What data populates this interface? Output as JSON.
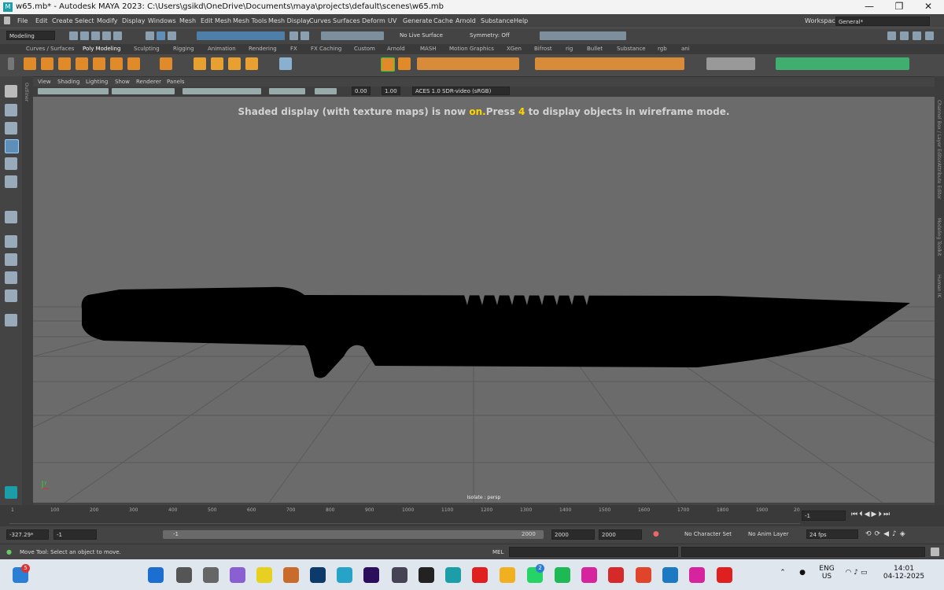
{
  "window": {
    "title": "w65.mb* - Autodesk MAYA 2023: C:\\Users\\gsikd\\OneDrive\\Documents\\maya\\projects\\default\\scenes\\w65.mb",
    "minimize": "—",
    "maximize": "❐",
    "close": "✕"
  },
  "menus": [
    "File",
    "Edit",
    "Create",
    "Select",
    "Modify",
    "Display",
    "Windows",
    "Mesh",
    "Edit Mesh",
    "Mesh Tools",
    "Mesh Display",
    "Curves",
    "Surfaces",
    "Deform",
    "UV",
    "Generate",
    "Cache",
    "Arnold",
    "Substance",
    "Help"
  ],
  "workspace": {
    "label": "Workspace:",
    "value": "General*"
  },
  "status": {
    "mode": "Modeling",
    "live_surface": "No Live Surface",
    "symmetry": "Symmetry: Off"
  },
  "shelf_tabs": [
    "Curves / Surfaces",
    "Poly Modeling",
    "Sculpting",
    "Rigging",
    "Animation",
    "Rendering",
    "FX",
    "FX Caching",
    "Custom",
    "Arnold",
    "MASH",
    "Motion Graphics",
    "XGen",
    "Bifrost",
    "rig",
    "Bullet",
    "Substance",
    "rgb",
    "ani"
  ],
  "shelf_active": "Poly Modeling",
  "panel_menu": [
    "View",
    "Shading",
    "Lighting",
    "Show",
    "Renderer",
    "Panels"
  ],
  "panel_toolbar": {
    "exposure": "0.00",
    "gamma": "1.00",
    "colorspace": "ACES 1.0 SDR-video (sRGB)"
  },
  "viewport": {
    "hud_pre": "Shaded display (with texture maps) is now ",
    "hud_on": "on.",
    "hud_mid": "Press ",
    "hud_key": "4",
    "hud_post": " to display objects in wireframe mode.",
    "isolate": "Isolate : persp",
    "axis_y": "y"
  },
  "side_labels": {
    "outliner": "Outliner",
    "channel_box": "Channel Box / Layer Editor",
    "attribute_editor": "Attribute Editor",
    "modeling_toolkit": "Modeling Toolkit",
    "human_ik": "Human IK"
  },
  "timeline": {
    "ticks": [
      "1",
      "100",
      "200",
      "300",
      "400",
      "500",
      "600",
      "700",
      "800",
      "900",
      "1000",
      "1100",
      "1200",
      "1300",
      "1400",
      "1500",
      "1600",
      "1700",
      "1800",
      "1900",
      "20"
    ],
    "current": "-1"
  },
  "range": {
    "start_field": "-327.29*",
    "start2": "-1",
    "slider_start": "-1",
    "slider_end": "2000",
    "end_field": "2000",
    "end2": "2000",
    "character_set": "No Character Set",
    "anim_layer": "No Anim Layer",
    "fps": "24 fps"
  },
  "cmdline": {
    "help": "Move Tool: Select an object to move.",
    "lang": "MEL"
  },
  "taskbar": {
    "lang1": "ENG",
    "lang2": "US",
    "time": "14:01",
    "date": "04-12-2025",
    "notif_count": "5",
    "whatsapp_badge": "2"
  },
  "colors": {
    "viewport": "#6b6b6b",
    "hud_highlight": "#ffd400",
    "ui_bg": "#444444"
  }
}
